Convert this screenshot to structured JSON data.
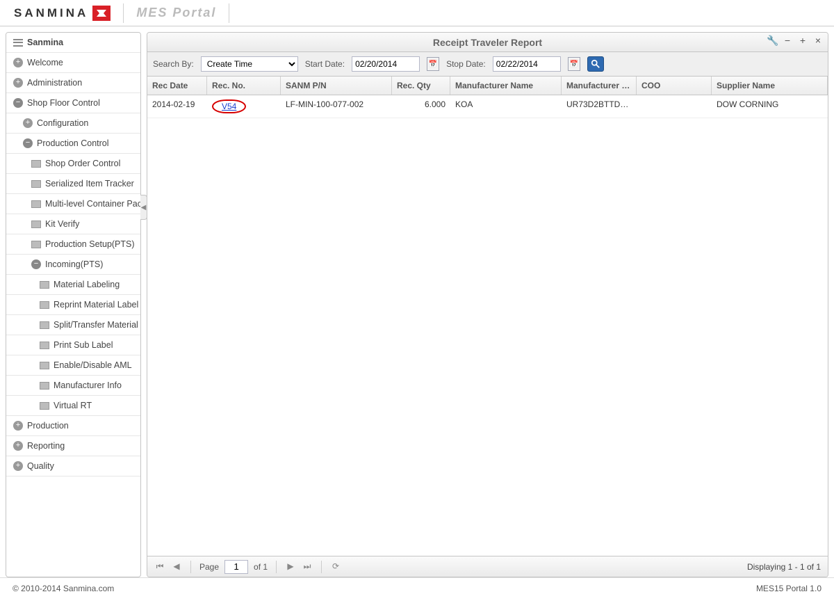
{
  "brand": {
    "name": "SANMINA",
    "portal_title": "MES Portal"
  },
  "sidebar": {
    "items": [
      {
        "label": "Sanmina",
        "icon": "header"
      },
      {
        "label": "Welcome",
        "state": "closed"
      },
      {
        "label": "Administration",
        "state": "closed"
      },
      {
        "label": "Shop Floor Control",
        "state": "open",
        "children": [
          {
            "label": "Configuration",
            "state": "closed"
          },
          {
            "label": "Production Control",
            "state": "open",
            "children": [
              {
                "label": "Shop Order Control"
              },
              {
                "label": "Serialized Item Tracker"
              },
              {
                "label": "Multi-level Container Pack..."
              },
              {
                "label": "Kit Verify"
              },
              {
                "label": "Production Setup(PTS)"
              },
              {
                "label": "Incoming(PTS)",
                "state": "open",
                "children": [
                  {
                    "label": "Material Labeling"
                  },
                  {
                    "label": "Reprint Material Label"
                  },
                  {
                    "label": "Split/Transfer Material"
                  },
                  {
                    "label": "Print Sub Label"
                  },
                  {
                    "label": "Enable/Disable AML"
                  },
                  {
                    "label": "Manufacturer Info"
                  },
                  {
                    "label": "Virtual RT"
                  }
                ]
              }
            ]
          }
        ]
      },
      {
        "label": "Production",
        "state": "closed"
      },
      {
        "label": "Reporting",
        "state": "closed"
      },
      {
        "label": "Quality",
        "state": "closed"
      }
    ]
  },
  "panel": {
    "title": "Receipt Traveler Report",
    "filters": {
      "search_by_label": "Search By:",
      "search_by_value": "Create Time",
      "start_date_label": "Start Date:",
      "start_date_value": "02/20/2014",
      "stop_date_label": "Stop Date:",
      "stop_date_value": "02/22/2014"
    },
    "columns": [
      "Rec Date",
      "Rec. No.",
      "SANM P/N",
      "Rec. Qty",
      "Manufacturer Name",
      "Manufacturer PN",
      "COO",
      "Supplier Name"
    ],
    "rows": [
      {
        "rec_date": "2014-02-19",
        "rec_no": "V54",
        "sanm_pn": "LF-MIN-100-077-002",
        "rec_qty": "6.000",
        "mfr_name": "KOA",
        "mfr_pn": "UR73D2BTTD20...",
        "coo": "",
        "supplier": "DOW CORNING"
      }
    ],
    "paging": {
      "page_label": "Page",
      "page_value": "1",
      "of_label": "of 1",
      "status": "Displaying 1 - 1 of 1"
    }
  },
  "footer": {
    "copyright": "© 2010-2014 Sanmina.com",
    "version": "MES15 Portal 1.0"
  }
}
